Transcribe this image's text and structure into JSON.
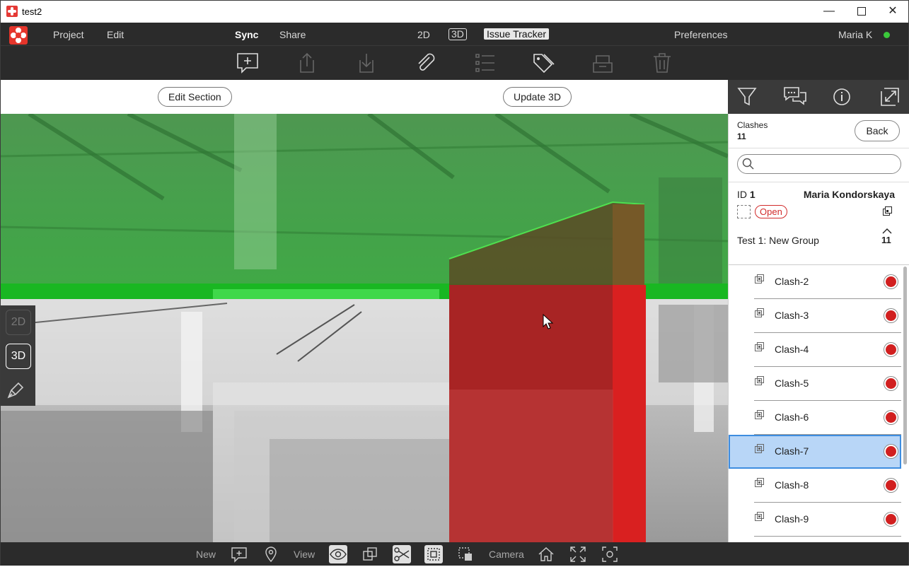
{
  "window": {
    "title": "test2"
  },
  "menu": {
    "project": "Project",
    "edit": "Edit",
    "sync": "Sync",
    "share": "Share",
    "view2d": "2D",
    "view3d": "3D",
    "issue_tracker": "Issue Tracker",
    "preferences": "Preferences",
    "user": "Maria K"
  },
  "section_bar": {
    "edit_section": "Edit Section",
    "update_3d": "Update 3D"
  },
  "left_dock": {
    "btn_2d": "2D",
    "btn_3d": "3D"
  },
  "panel": {
    "clashes_label": "Clashes",
    "clashes_count": "11",
    "back": "Back",
    "search_placeholder": "",
    "id_label": "ID",
    "id_value": "1",
    "assignee": "Maria Kondorskaya",
    "status": "Open",
    "group": "Test 1: New Group",
    "group_count": "11",
    "items": [
      {
        "label": "Clash-2",
        "selected": false
      },
      {
        "label": "Clash-3",
        "selected": false
      },
      {
        "label": "Clash-4",
        "selected": false
      },
      {
        "label": "Clash-5",
        "selected": false
      },
      {
        "label": "Clash-6",
        "selected": false
      },
      {
        "label": "Clash-7",
        "selected": true
      },
      {
        "label": "Clash-8",
        "selected": false
      },
      {
        "label": "Clash-9",
        "selected": false
      }
    ]
  },
  "bottom_bar": {
    "new": "New",
    "view": "View",
    "camera": "Camera"
  },
  "colors": {
    "accent_red": "#e5352b",
    "status_red": "#d11f1f",
    "selection": "#b8d6f7",
    "online": "#3bc83b"
  }
}
